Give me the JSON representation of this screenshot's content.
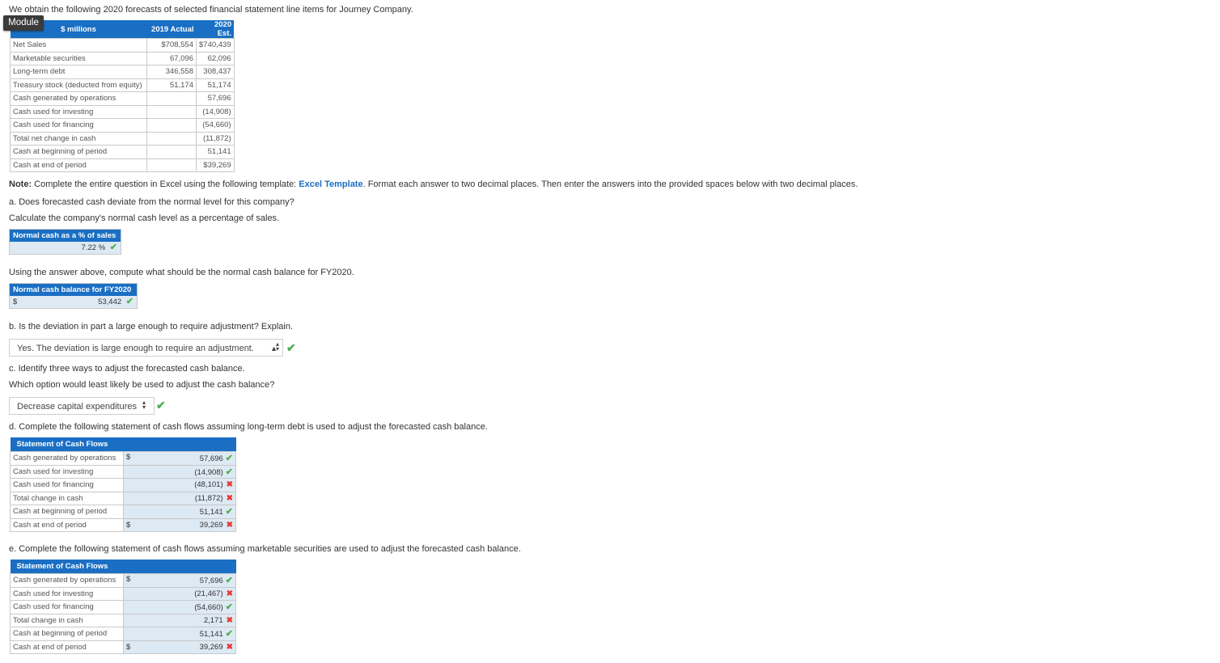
{
  "intro": "We obtain the following 2020 forecasts of selected financial statement line items for Journey Company.",
  "module_tag": "Module",
  "forecast_table": {
    "header": [
      "$ millions",
      "2019 Actual",
      "2020 Est."
    ],
    "rows": [
      {
        "label": "Net Sales",
        "a2019": "$708,554",
        "e2020": "$740,439"
      },
      {
        "label": "Marketable securities",
        "a2019": "67,096",
        "e2020": "62,096"
      },
      {
        "label": "Long-term debt",
        "a2019": "346,558",
        "e2020": "308,437"
      },
      {
        "label": "Treasury stock (deducted from equity)",
        "a2019": "51,174",
        "e2020": "51,174"
      },
      {
        "label": "Cash generated by operations",
        "a2019": "",
        "e2020": "57,696"
      },
      {
        "label": "Cash used for investing",
        "a2019": "",
        "e2020": "(14,908)"
      },
      {
        "label": "Cash used for financing",
        "a2019": "",
        "e2020": "(54,660)"
      },
      {
        "label": "Total net change in cash",
        "a2019": "",
        "e2020": "(11,872)"
      },
      {
        "label": "Cash at beginning of period",
        "a2019": "",
        "e2020": "51,141"
      },
      {
        "label": "Cash at end of period",
        "a2019": "",
        "e2020": "$39,269"
      }
    ]
  },
  "note": {
    "bold": "Note:",
    "pre": " Complete the entire question in Excel using the following template: ",
    "link": "Excel Template",
    "post": ". Format each answer to two decimal places. Then enter the answers into the provided spaces below with two decimal places."
  },
  "part_a": {
    "q1": "a. Does forecasted cash deviate from the normal level for this company?",
    "q2": "Calculate the company's normal cash level as a percentage of sales.",
    "box1_header": "Normal cash as a % of sales",
    "box1_value": "7.22",
    "box1_unit": "%",
    "q3": "Using the answer above, compute what should be the normal cash balance for FY2020.",
    "box2_header": "Normal cash balance for FY2020",
    "box2_dollar": "$",
    "box2_value": "53,442"
  },
  "part_b": {
    "q": "b. Is the deviation in part a large enough to require adjustment? Explain.",
    "selected": "Yes. The deviation is large enough to require an adjustment."
  },
  "part_c": {
    "q1": "c. Identify three ways to adjust the forecasted cash balance.",
    "q2": "Which option would least likely be used to adjust the cash balance?",
    "selected": "Decrease capital expenditures"
  },
  "part_d": {
    "q": "d. Complete the following statement of cash flows assuming long-term debt is used to adjust the forecasted cash balance.",
    "header": "Statement of Cash Flows",
    "rows": [
      {
        "label": "Cash generated by operations",
        "dollar": "$",
        "value": "57,696",
        "status": "correct"
      },
      {
        "label": "Cash used for investing",
        "dollar": "",
        "value": "(14,908)",
        "status": "correct"
      },
      {
        "label": "Cash used for financing",
        "dollar": "",
        "value": "(48,101)",
        "status": "incorrect"
      },
      {
        "label": "Total change in cash",
        "dollar": "",
        "value": "(11,872)",
        "status": "incorrect"
      },
      {
        "label": "Cash at beginning of period",
        "dollar": "",
        "value": "51,141",
        "status": "correct"
      },
      {
        "label": "Cash at end of period",
        "dollar": "$",
        "value": "39,269",
        "status": "incorrect"
      }
    ]
  },
  "part_e": {
    "q": "e. Complete the following statement of cash flows assuming marketable securities are used to adjust the forecasted cash balance.",
    "header": "Statement of Cash Flows",
    "rows": [
      {
        "label": "Cash generated by operations",
        "dollar": "$",
        "value": "57,696",
        "status": "correct"
      },
      {
        "label": "Cash used for investing",
        "dollar": "",
        "value": "(21,467)",
        "status": "incorrect"
      },
      {
        "label": "Cash used for financing",
        "dollar": "",
        "value": "(54,660)",
        "status": "correct"
      },
      {
        "label": "Total change in cash",
        "dollar": "",
        "value": "2,171",
        "status": "incorrect"
      },
      {
        "label": "Cash at beginning of period",
        "dollar": "",
        "value": "51,141",
        "status": "correct"
      },
      {
        "label": "Cash at end of period",
        "dollar": "$",
        "value": "39,269",
        "status": "incorrect"
      }
    ]
  },
  "colors": {
    "accent": "#1a6fc4",
    "input_bg": "#dde9f3",
    "correct": "#4caf50",
    "incorrect": "#e53935"
  }
}
